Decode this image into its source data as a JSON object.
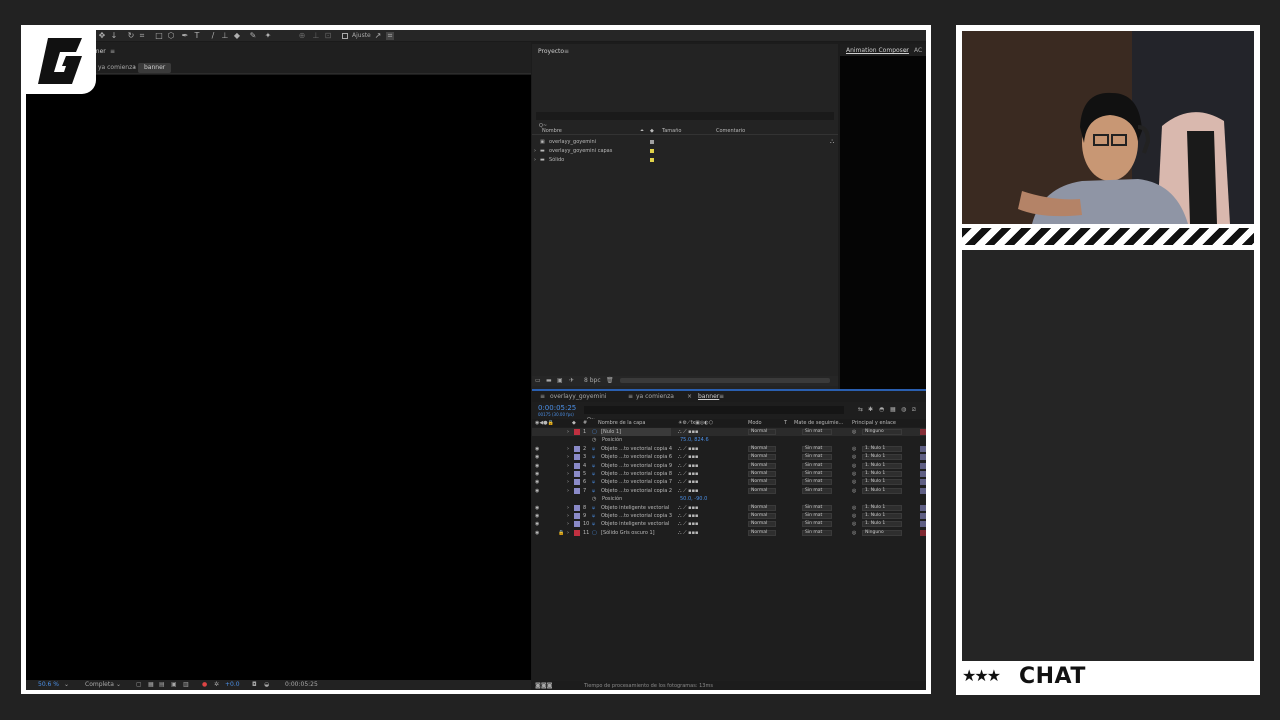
{
  "app": {
    "toolbar": {
      "snapping_label": "Ajuste"
    },
    "viewer": {
      "tab_partial": "nner",
      "breadcrumbs": [
        "ya comienza",
        "banner"
      ],
      "zoom": "50.6  %",
      "quality": "Completa",
      "exposure": "+0.0",
      "timecode": "0:00:05:25"
    },
    "project": {
      "title": "Proyecto",
      "search_placeholder": "Q~",
      "columns": [
        "Nombre",
        "Tamaño",
        "Comentario"
      ],
      "items": [
        {
          "name": "overlayy_goyemini",
          "label_color": "#a0a0a0",
          "expandable": false
        },
        {
          "name": "overlayy_goyemini capas",
          "label_color": "#e0d24a",
          "expandable": true
        },
        {
          "name": "Sólido",
          "label_color": "#e0d24a",
          "expandable": true
        }
      ],
      "bpc": "8 bpc"
    },
    "right_panel": {
      "title": "Animation Composer",
      "title_partial": "AC"
    },
    "timeline": {
      "tabs": [
        "overlayy_goyemini",
        "ya comienza",
        "banner"
      ],
      "active_tab": "banner",
      "current_time": "0:00:05:25",
      "frame_info": "00175 (30.00 fps)",
      "search_placeholder": "Q~",
      "columns": {
        "layer_name": "Nombre de la capa",
        "mode": "Modo",
        "t": "T",
        "track_matte": "Mate de seguimie...",
        "parent": "Principal y enlace"
      },
      "layers": [
        {
          "num": "1",
          "name": "[Nulo 1]",
          "color": "#c03040",
          "mode": "Normal",
          "matte": "Sin mat",
          "parent": "Ninguno",
          "kind": "null",
          "selected": true
        },
        {
          "prop": true,
          "name": "Posición",
          "value": "75.0, 824.6"
        },
        {
          "num": "2",
          "name": "Objeto ...to vectorial copia 4",
          "color": "#8a8ac8",
          "mode": "Normal",
          "matte": "Sin mat",
          "parent": "1. Nulo 1",
          "kind": "shape"
        },
        {
          "num": "3",
          "name": "Objeto ...to vectorial copia 6",
          "color": "#8a8ac8",
          "mode": "Normal",
          "matte": "Sin mat",
          "parent": "1. Nulo 1",
          "kind": "shape"
        },
        {
          "num": "4",
          "name": "Objeto ...to vectorial copia 9",
          "color": "#8a8ac8",
          "mode": "Normal",
          "matte": "Sin mat",
          "parent": "1. Nulo 1",
          "kind": "shape"
        },
        {
          "num": "5",
          "name": "Objeto ...to vectorial copia 8",
          "color": "#8a8ac8",
          "mode": "Normal",
          "matte": "Sin mat",
          "parent": "1. Nulo 1",
          "kind": "shape"
        },
        {
          "num": "6",
          "name": "Objeto ...to vectorial copia 7",
          "color": "#8a8ac8",
          "mode": "Normal",
          "matte": "Sin mat",
          "parent": "1. Nulo 1",
          "kind": "shape"
        },
        {
          "num": "7",
          "name": "Objeto ...to vectorial copia 2",
          "color": "#8a8ac8",
          "mode": "Normal",
          "matte": "Sin mat",
          "parent": "1. Nulo 1",
          "kind": "shape"
        },
        {
          "prop": true,
          "name": "Posición",
          "value": "50.0, -90.0"
        },
        {
          "num": "8",
          "name": "Objeto inteligente vectorial",
          "color": "#8a8ac8",
          "mode": "Normal",
          "matte": "Sin mat",
          "parent": "1. Nulo 1",
          "kind": "shape"
        },
        {
          "num": "9",
          "name": "Objeto ...to vectorial copia 3",
          "color": "#8a8ac8",
          "mode": "Normal",
          "matte": "Sin mat",
          "parent": "1. Nulo 1",
          "kind": "shape"
        },
        {
          "num": "10",
          "name": "Objeto inteligente vectorial",
          "color": "#8a8ac8",
          "mode": "Normal",
          "matte": "Sin mat",
          "parent": "1. Nulo 1",
          "kind": "shape"
        },
        {
          "num": "11",
          "name": "[Sólido Gris oscuro 1]",
          "color": "#c03040",
          "mode": "Normal",
          "matte": "Sin mat",
          "parent": "Ninguno",
          "kind": "solid"
        }
      ],
      "footer": "Tiempo de procesamiento de los fotogramas: 13ms"
    }
  },
  "overlay": {
    "logo_letter": "G",
    "chat_label": "CHAT",
    "chat_stars": "★★★"
  }
}
